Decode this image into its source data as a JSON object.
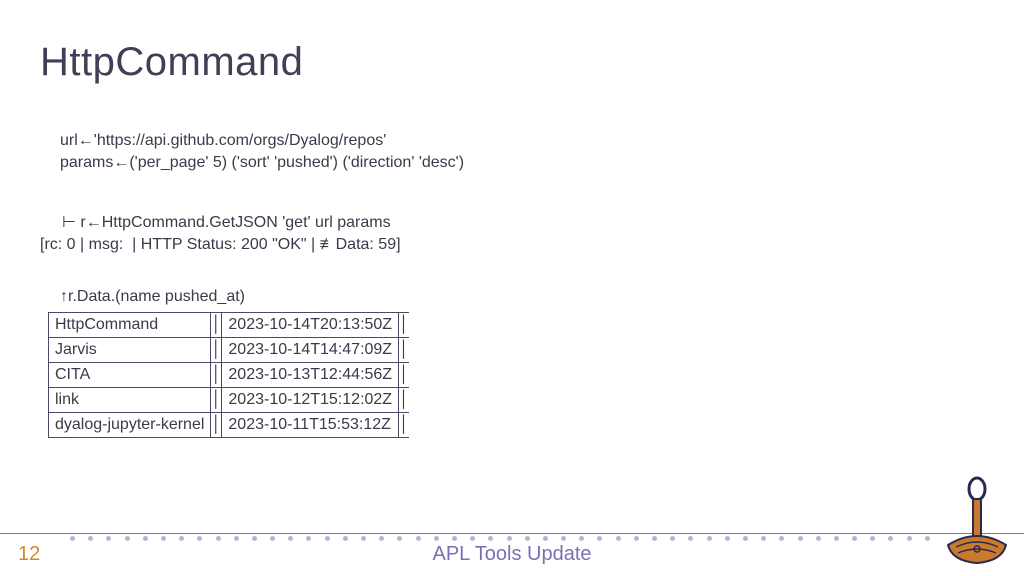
{
  "title": "HttpCommand",
  "code": {
    "line1": "url←'https://api.github.com/orgs/Dyalog/repos'",
    "line2": "params←('per_page' 5) ('sort' 'pushed') ('direction' 'desc')",
    "line3": "⊢ r←HttpCommand.GetJSON 'get' url params",
    "line4": "[rc: 0 | msg:  | HTTP Status: 200 \"OK\" | ≢Data: 59]",
    "data_expr": "↑r.Data.(name pushed_at)"
  },
  "table": {
    "rows": [
      {
        "name": "HttpCommand",
        "ts": "2023-10-14T20:13:50Z"
      },
      {
        "name": "Jarvis",
        "ts": "2023-10-14T14:47:09Z"
      },
      {
        "name": "CITA",
        "ts": "2023-10-13T12:44:56Z"
      },
      {
        "name": "link",
        "ts": "2023-10-12T15:12:02Z"
      },
      {
        "name": "dyalog-jupyter-kernel",
        "ts": "2023-10-11T15:53:12Z"
      }
    ]
  },
  "footer": {
    "page": "12",
    "title": "APL Tools Update",
    "dot_count": 48
  }
}
